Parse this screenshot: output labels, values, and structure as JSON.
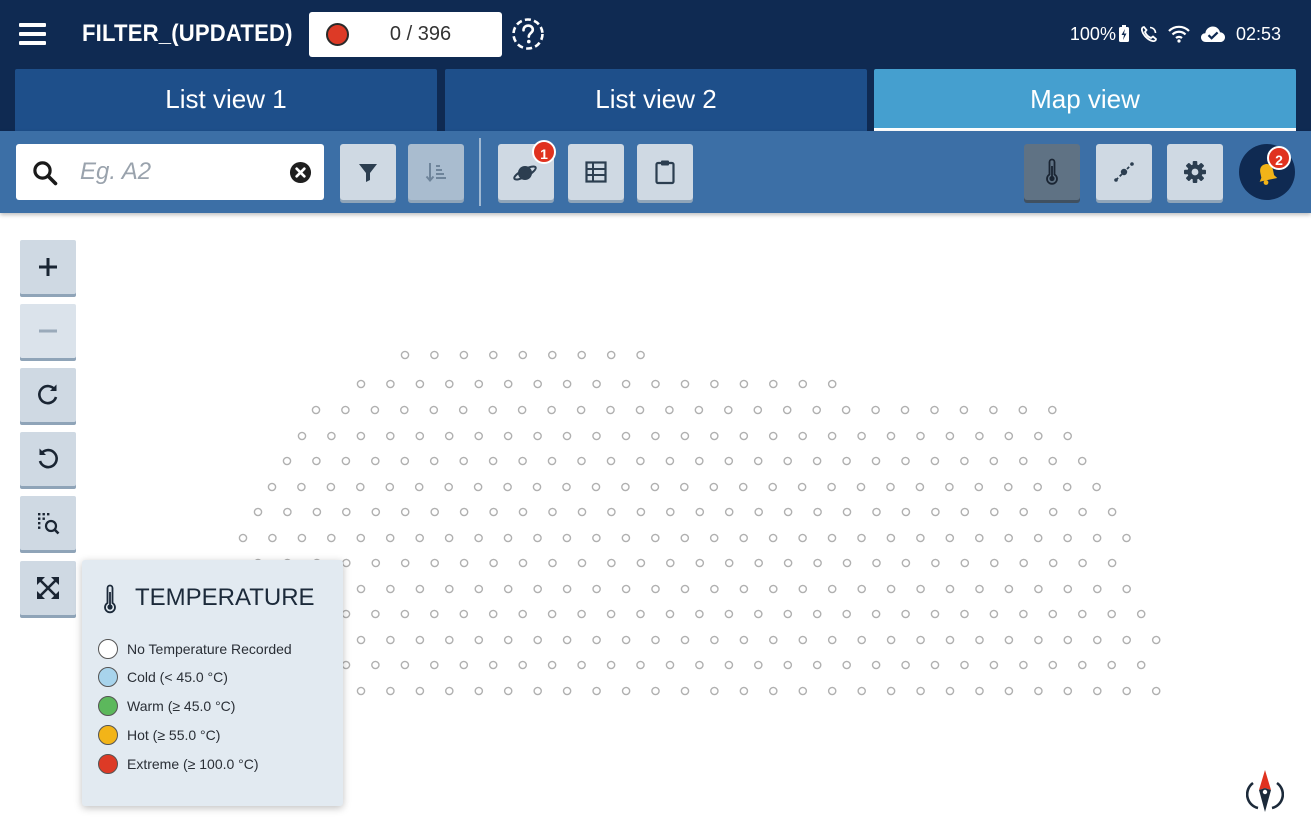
{
  "header": {
    "title": "FILTER_(UPDATED)",
    "counter": "0 / 396",
    "status": {
      "battery": "100%",
      "time": "02:53"
    }
  },
  "tabs": [
    {
      "label": "List view 1",
      "active": false
    },
    {
      "label": "List view 2",
      "active": false
    },
    {
      "label": "Map view",
      "active": true
    }
  ],
  "toolbar": {
    "search_placeholder": "Eg. A2",
    "search_value": "",
    "badges": {
      "layers": "1",
      "notifications": "2"
    }
  },
  "legend": {
    "title": "TEMPERATURE",
    "items": [
      {
        "label": "No Temperature Recorded",
        "color": "#ffffff"
      },
      {
        "label": "Cold (< 45.0 °C)",
        "color": "#a8d4ec"
      },
      {
        "label": "Warm (≥ 45.0 °C)",
        "color": "#5cb85c"
      },
      {
        "label": "Hot (≥ 55.0 °C)",
        "color": "#f2b418"
      },
      {
        "label": "Extreme (≥ 100.0 °C)",
        "color": "#dd3a26"
      }
    ]
  },
  "colors": {
    "header_bg": "#0f2a52",
    "tab_inactive": "#1e4f8a",
    "tab_active": "#459fcf",
    "toolbar_bg": "#3c6fa6",
    "dot_stroke": "#b0b0b0"
  }
}
